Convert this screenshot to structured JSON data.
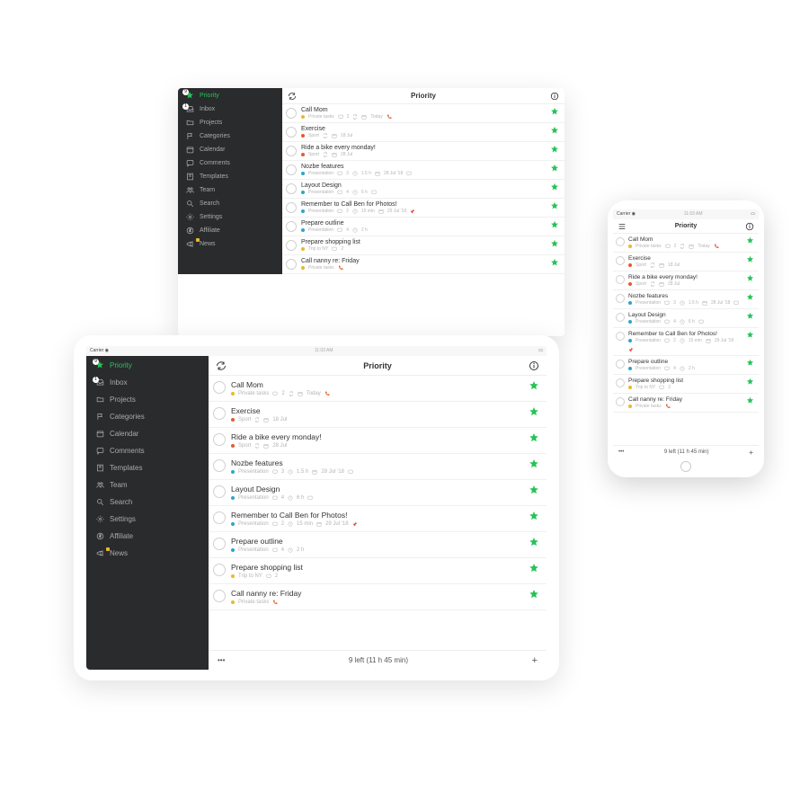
{
  "status": {
    "carrier": "Carrier",
    "wifi_icon": "wifi",
    "time": "11:03 AM",
    "battery_icon": "battery"
  },
  "header": {
    "title": "Priority",
    "refresh_icon": "refresh",
    "menu_icon": "menu",
    "info_icon": "info"
  },
  "footer": {
    "summary": "9 left (11 h 45 min)",
    "more_icon": "more",
    "add_icon": "add"
  },
  "sidebar": {
    "items": [
      {
        "key": "priority",
        "label": "Priority",
        "icon": "star",
        "active": true,
        "badge_count": "9"
      },
      {
        "key": "inbox",
        "label": "Inbox",
        "icon": "inbox",
        "badge_count": "1"
      },
      {
        "key": "projects",
        "label": "Projects",
        "icon": "folder"
      },
      {
        "key": "categories",
        "label": "Categories",
        "icon": "flag"
      },
      {
        "key": "calendar",
        "label": "Calendar",
        "icon": "calendar"
      },
      {
        "key": "comments",
        "label": "Comments",
        "icon": "comments"
      },
      {
        "key": "templates",
        "label": "Templates",
        "icon": "templates"
      },
      {
        "key": "team",
        "label": "Team",
        "icon": "team"
      },
      {
        "key": "search",
        "label": "Search",
        "icon": "search"
      },
      {
        "key": "settings",
        "label": "Settings",
        "icon": "gear"
      },
      {
        "key": "affiliate",
        "label": "Affiliate",
        "icon": "dollar"
      },
      {
        "key": "news",
        "label": "News",
        "icon": "megaphone",
        "notify": true
      }
    ]
  },
  "colors": {
    "accent_green": "#27c257",
    "project": {
      "private": "#e9b82d",
      "sport": "#e35b2f",
      "presentation": "#2aa7c9",
      "trip": "#e9b82d"
    }
  },
  "tasks": [
    {
      "title": "Call Mom",
      "project": "Private tasks",
      "project_color": "private",
      "meta": [
        {
          "icon": "comment",
          "text": "2"
        },
        {
          "icon": "repeat"
        },
        {
          "icon": "calendar",
          "text": "Today"
        },
        {
          "icon": "phone",
          "color": "#e35b2f"
        }
      ]
    },
    {
      "title": "Exercise",
      "project": "Sport",
      "project_color": "sport",
      "meta": [
        {
          "icon": "repeat"
        },
        {
          "icon": "calendar",
          "text": "18 Jul"
        }
      ]
    },
    {
      "title": "Ride a bike every monday!",
      "project": "Sport",
      "project_color": "sport",
      "meta": [
        {
          "icon": "repeat"
        },
        {
          "icon": "calendar",
          "text": "28 Jul"
        }
      ]
    },
    {
      "title": "Nozbe features",
      "project": "Presentation",
      "project_color": "presentation",
      "meta": [
        {
          "icon": "comment",
          "text": "3"
        },
        {
          "icon": "clock",
          "text": "1.5 h"
        },
        {
          "icon": "calendar",
          "text": "28 Jul '18"
        },
        {
          "icon": "comment"
        }
      ]
    },
    {
      "title": "Layout Design",
      "project": "Presentation",
      "project_color": "presentation",
      "meta": [
        {
          "icon": "comment",
          "text": "4"
        },
        {
          "icon": "clock",
          "text": "6 h"
        },
        {
          "icon": "comment"
        }
      ]
    },
    {
      "title": "Remember to Call Ben for Photos!",
      "project": "Presentation",
      "project_color": "presentation",
      "meta": [
        {
          "icon": "comment",
          "text": "2"
        },
        {
          "icon": "clock",
          "text": "15 min"
        },
        {
          "icon": "calendar",
          "text": "29 Jul '18"
        },
        {
          "icon": "pin",
          "color": "#e8453c"
        }
      ]
    },
    {
      "title": "Prepare outline",
      "project": "Presentation",
      "project_color": "presentation",
      "meta": [
        {
          "icon": "comment",
          "text": "4"
        },
        {
          "icon": "clock",
          "text": "2 h"
        }
      ]
    },
    {
      "title": "Prepare shopping list",
      "project": "Trip to NY",
      "project_color": "trip",
      "meta": [
        {
          "icon": "comment",
          "text": "2"
        }
      ]
    },
    {
      "title": "Call nanny re: Friday",
      "project": "Private tasks",
      "project_color": "private",
      "meta": [
        {
          "icon": "phone",
          "color": "#e35b2f"
        }
      ]
    }
  ]
}
